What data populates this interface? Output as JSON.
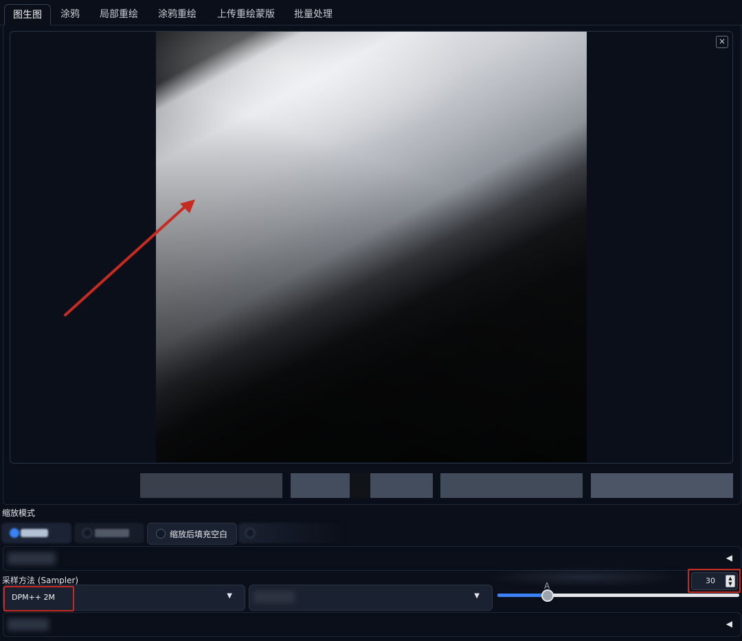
{
  "tabs": [
    {
      "label": "图生图",
      "active": true
    },
    {
      "label": "涂鸦",
      "active": false
    },
    {
      "label": "局部重绘",
      "active": false
    },
    {
      "label": "涂鸦重绘",
      "active": false
    },
    {
      "label": "上传重绘蒙版",
      "active": false
    },
    {
      "label": "批量处理",
      "active": false
    }
  ],
  "image_panel": {
    "close_glyph": "×"
  },
  "resize_mode": {
    "label": "缩放模式",
    "options": [
      {
        "label": "",
        "checked": true
      },
      {
        "label": "",
        "checked": false
      },
      {
        "label": "缩放后填充空白",
        "checked": false
      },
      {
        "label": "",
        "checked": false
      }
    ]
  },
  "accordion_top": {
    "arrow": "◀"
  },
  "sampler": {
    "label": "采样方法 (Sampler)",
    "selected": "DPM++ 2M",
    "caret": "▼",
    "second_caret": "▼"
  },
  "steps": {
    "value": "30",
    "slider_value": 30,
    "slider_min": 1,
    "slider_max": 150,
    "spin_up": "▲",
    "spin_down": "▼",
    "cap": "A"
  },
  "accordion_bottom": {
    "arrow": "◀"
  },
  "colors": {
    "background": "#0b0f19",
    "accent": "#3b82f6",
    "highlight": "#c62a21"
  }
}
